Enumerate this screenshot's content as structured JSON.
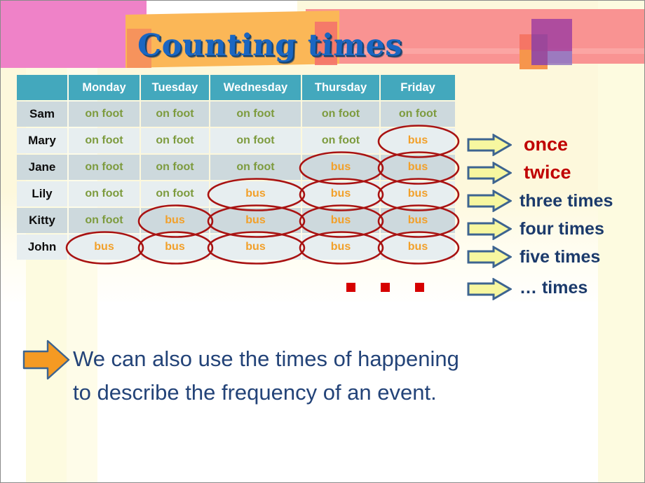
{
  "slide": {
    "title": "Counting times",
    "colors": {
      "title_blue": "#1a66c2",
      "header_teal": "#43a8bd",
      "row_dark": "#cdd9dd",
      "row_light": "#e7eef0",
      "on_foot_green": "#7d9b3e",
      "bus_orange": "#f2a02a",
      "ellipse_red": "#a81212",
      "label_red": "#c00000",
      "label_navy": "#1b3a6b",
      "arrow_yellow": "#f7f7a0",
      "arrow_border": "#3d6490",
      "big_arrow_orange": "#f59a23",
      "background_cream": "#fdf8dc",
      "red_dot": "#d60000"
    }
  },
  "table": {
    "columns": [
      "",
      "Monday",
      "Tuesday",
      "Wednesday",
      "Thursday",
      "Friday"
    ],
    "rows": [
      {
        "name": "Sam",
        "values": [
          "on foot",
          "on foot",
          "on foot",
          "on foot",
          "on foot"
        ],
        "circled": [
          false,
          false,
          false,
          false,
          false
        ]
      },
      {
        "name": "Mary",
        "values": [
          "on foot",
          "on foot",
          "on foot",
          "on foot",
          "bus"
        ],
        "circled": [
          false,
          false,
          false,
          false,
          true
        ]
      },
      {
        "name": "Jane",
        "values": [
          "on foot",
          "on foot",
          "on foot",
          "bus",
          "bus"
        ],
        "circled": [
          false,
          false,
          false,
          true,
          true
        ]
      },
      {
        "name": "Lily",
        "values": [
          "on foot",
          "on foot",
          "bus",
          "bus",
          "bus"
        ],
        "circled": [
          false,
          false,
          true,
          true,
          true
        ]
      },
      {
        "name": "Kitty",
        "values": [
          "on foot",
          "bus",
          "bus",
          "bus",
          "bus"
        ],
        "circled": [
          false,
          true,
          true,
          true,
          true
        ]
      },
      {
        "name": "John",
        "values": [
          "bus",
          "bus",
          "bus",
          "bus",
          "bus"
        ],
        "circled": [
          true,
          true,
          true,
          true,
          true
        ]
      }
    ]
  },
  "frequency_labels": [
    {
      "text": "once",
      "style": "red"
    },
    {
      "text": "twice",
      "style": "red"
    },
    {
      "text": "three times",
      "style": "navy"
    },
    {
      "text": "four times",
      "style": "navy"
    },
    {
      "text": "five times",
      "style": "navy"
    },
    {
      "text": "… times",
      "style": "navy"
    }
  ],
  "ellipsis_dots": 3,
  "callout": {
    "line1": "We can also use the times of happening",
    "line2": "to describe the frequency of an event."
  }
}
